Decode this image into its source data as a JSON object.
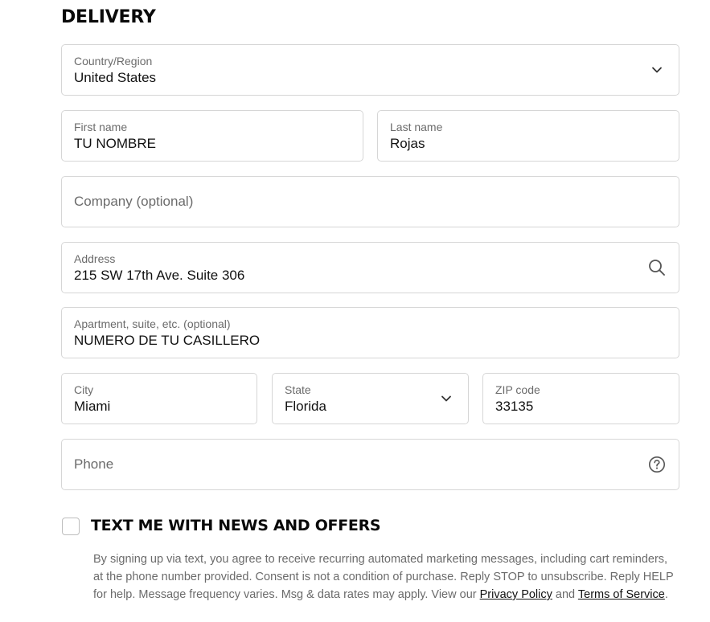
{
  "section": {
    "title": "DELIVERY"
  },
  "fields": {
    "country": {
      "label": "Country/Region",
      "value": "United States"
    },
    "first_name": {
      "label": "First name",
      "value": "TU NOMBRE"
    },
    "last_name": {
      "label": "Last name",
      "value": "Rojas"
    },
    "company": {
      "placeholder": "Company (optional)"
    },
    "address": {
      "label": "Address",
      "value": "215 SW 17th Ave. Suite 306"
    },
    "apartment": {
      "label": "Apartment, suite, etc. (optional)",
      "value": "NUMERO DE TU CASILLERO"
    },
    "city": {
      "label": "City",
      "value": "Miami"
    },
    "state": {
      "label": "State",
      "value": "Florida"
    },
    "zip": {
      "label": "ZIP code",
      "value": "33135"
    },
    "phone": {
      "placeholder": "Phone"
    }
  },
  "sms_optin": {
    "label": "TEXT ME WITH NEWS AND OFFERS",
    "disclaimer_text": "By signing up via text, you agree to receive recurring automated marketing messages, including cart reminders, at the phone number provided. Consent is not a condition of purchase. Reply STOP to unsubscribe. Reply HELP for help. Message frequency varies. Msg & data rates may apply. View our ",
    "privacy_link": "Privacy Policy",
    "and_text": " and ",
    "terms_link": "Terms of Service",
    "end_text": "."
  },
  "icons": {
    "select_chevron": "chevron-down-icon",
    "address_search": "search-icon",
    "phone_help": "help-circle-icon"
  },
  "colors": {
    "border": "#d6d6d6",
    "label": "#6b6b6b",
    "text": "#111111"
  }
}
